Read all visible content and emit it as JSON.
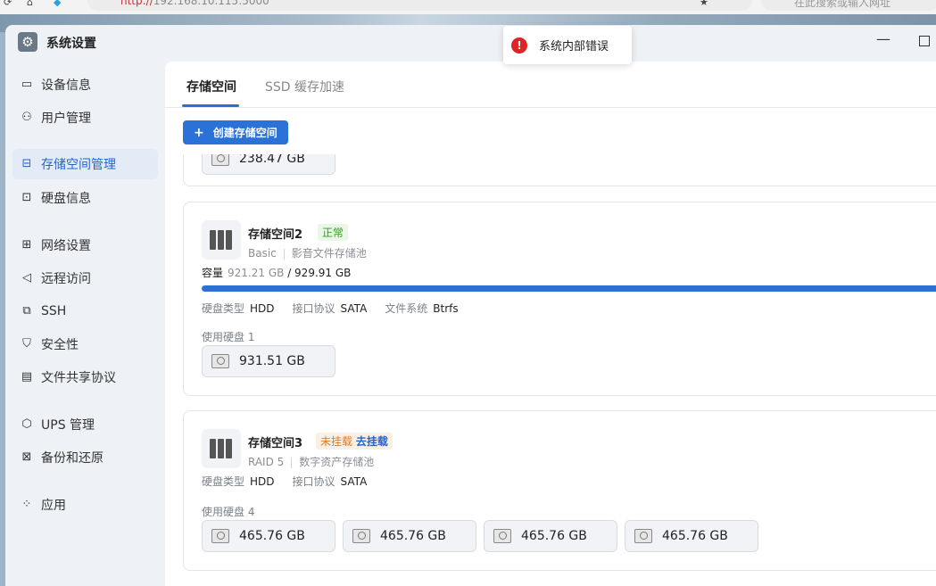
{
  "browser": {
    "url_scheme": "http://",
    "url_host": "192.168.10.115:5000",
    "search_placeholder": "在此搜索或输入网址"
  },
  "window": {
    "title": "系统设置",
    "minimize": "—"
  },
  "sidebar": {
    "items": [
      {
        "label": "设备信息",
        "icon": "device-icon",
        "glyph": "▭"
      },
      {
        "label": "用户管理",
        "icon": "user-icon",
        "glyph": "⚇"
      },
      {
        "label": "存储空间管理",
        "icon": "storage-icon",
        "glyph": "⊟"
      },
      {
        "label": "硬盘信息",
        "icon": "disk-icon",
        "glyph": "⊡"
      },
      {
        "label": "网络设置",
        "icon": "network-icon",
        "glyph": "⊞"
      },
      {
        "label": "远程访问",
        "icon": "remote-icon",
        "glyph": "◁"
      },
      {
        "label": "SSH",
        "icon": "ssh-icon",
        "glyph": "⧉"
      },
      {
        "label": "安全性",
        "icon": "shield-icon",
        "glyph": "⛉"
      },
      {
        "label": "文件共享协议",
        "icon": "file-share-icon",
        "glyph": "▤"
      },
      {
        "label": "UPS 管理",
        "icon": "ups-icon",
        "glyph": "⬡"
      },
      {
        "label": "备份和还原",
        "icon": "backup-icon",
        "glyph": "⊠"
      },
      {
        "label": "应用",
        "icon": "apps-icon",
        "glyph": "⁘"
      }
    ],
    "active_index": 2
  },
  "tabs": [
    {
      "label": "存储空间"
    },
    {
      "label": "SSD 缓存加速"
    }
  ],
  "create_button": {
    "plus": "+",
    "label": "创建存储空间"
  },
  "pools": [
    {
      "partial_disk_label": "238.47 GB"
    },
    {
      "name": "存储空间2",
      "status": "正常",
      "raid": "Basic",
      "description": "影音文件存储池",
      "capacity_label": "容量",
      "capacity_used": "921.21 GB",
      "capacity_total": "/ 929.91 GB",
      "usage_fraction": 0.99,
      "disk_type_label": "硬盘类型",
      "disk_type": "HDD",
      "interface_label": "接口协议",
      "interface": "SATA",
      "fs_label": "文件系统",
      "fs": "Btrfs",
      "disks_used_label": "使用硬盘 1",
      "disks": [
        "931.51 GB"
      ]
    },
    {
      "name": "存储空间3",
      "status": "未挂载",
      "status_action": "去挂载",
      "raid": "RAID 5",
      "description": "数字资产存储池",
      "disk_type_label": "硬盘类型",
      "disk_type": "HDD",
      "interface_label": "接口协议",
      "interface": "SATA",
      "disks_used_label": "使用硬盘 4",
      "disks": [
        "465.76 GB",
        "465.76 GB",
        "465.76 GB",
        "465.76 GB"
      ]
    }
  ],
  "toast": {
    "message": "系统内部错误",
    "icon": "error-icon"
  },
  "more_label": "···"
}
